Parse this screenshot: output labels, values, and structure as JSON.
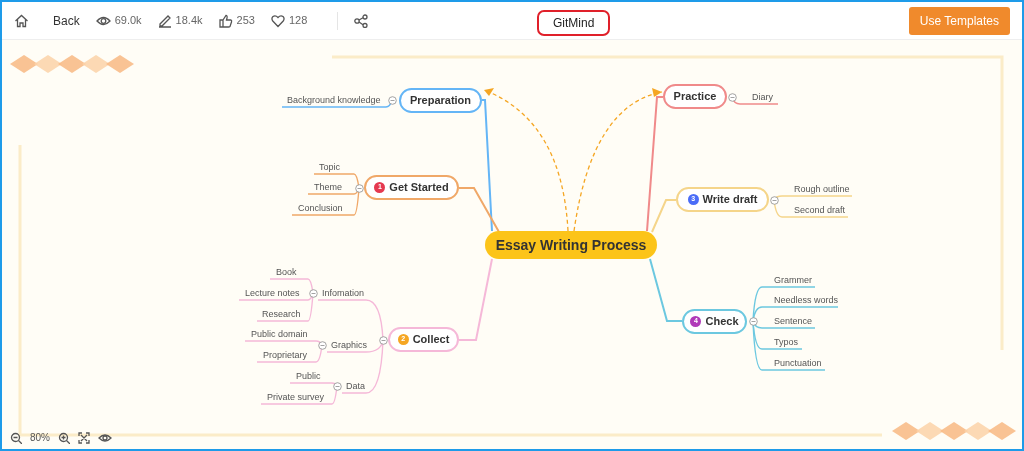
{
  "toolbar": {
    "back": "Back",
    "stats": [
      {
        "kind": "views",
        "value": "69.0k"
      },
      {
        "kind": "edits",
        "value": "18.4k"
      },
      {
        "kind": "likes",
        "value": "253"
      },
      {
        "kind": "favorites",
        "value": "128"
      }
    ],
    "title": "GitMind",
    "button": "Use Templates"
  },
  "mindmap": {
    "center": "Essay Writing Process",
    "branches": [
      {
        "label": "Preparation",
        "color": "#64b5f6",
        "related": true,
        "children": [
          {
            "label": "Background knowledge"
          }
        ]
      },
      {
        "label": "Get Started",
        "badge": "1",
        "color": "#f0a868",
        "related": false,
        "children": [
          {
            "label": "Topic"
          },
          {
            "label": "Theme"
          },
          {
            "label": "Conclusion"
          }
        ]
      },
      {
        "label": "Collect",
        "badge": "2",
        "color": "#f5b8d8",
        "related": false,
        "children": [
          {
            "label": "Infomation",
            "children": [
              {
                "label": "Book"
              },
              {
                "label": "Lecture notes"
              },
              {
                "label": "Research"
              }
            ]
          },
          {
            "label": "Graphics",
            "children": [
              {
                "label": "Public domain"
              },
              {
                "label": "Proprietary"
              }
            ]
          },
          {
            "label": "Data",
            "children": [
              {
                "label": "Public"
              },
              {
                "label": "Private survey"
              }
            ]
          }
        ]
      },
      {
        "label": "Practice",
        "color": "#f08a8a",
        "related": true,
        "children": [
          {
            "label": "Diary"
          }
        ]
      },
      {
        "label": "Write draft",
        "badge": "3",
        "color": "#f5d58a",
        "related": false,
        "children": [
          {
            "label": "Rough outline"
          },
          {
            "label": "Second draft"
          }
        ]
      },
      {
        "label": "Check",
        "badge": "4",
        "color": "#6cc8e0",
        "related": false,
        "children": [
          {
            "label": "Grammer"
          },
          {
            "label": "Needless words"
          },
          {
            "label": "Sentence"
          },
          {
            "label": "Typos"
          },
          {
            "label": "Punctuation"
          }
        ]
      }
    ]
  },
  "zoom": {
    "level": "80%"
  }
}
